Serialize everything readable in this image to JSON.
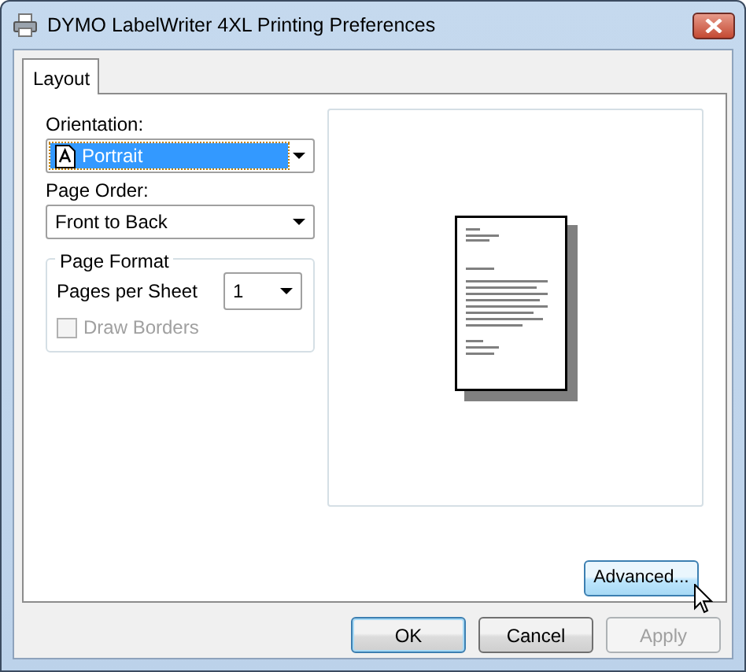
{
  "window": {
    "title": "DYMO LabelWriter 4XL Printing Preferences"
  },
  "tabs": [
    {
      "label": "Layout",
      "selected": true
    }
  ],
  "orientation": {
    "label": "Orientation:",
    "value": "Portrait",
    "focused": true
  },
  "page_order": {
    "label": "Page Order:",
    "value": "Front to Back"
  },
  "page_format": {
    "title": "Page Format",
    "pages_per_sheet": {
      "label": "Pages per Sheet",
      "value": "1"
    },
    "draw_borders": {
      "label": "Draw Borders",
      "checked": false,
      "disabled": true
    }
  },
  "advanced_button": {
    "label": "Advanced...",
    "hovered": true
  },
  "buttons": [
    {
      "label": "OK",
      "default": true,
      "disabled": false
    },
    {
      "label": "Cancel",
      "default": false,
      "disabled": false
    },
    {
      "label": "Apply",
      "default": false,
      "disabled": true
    }
  ]
}
